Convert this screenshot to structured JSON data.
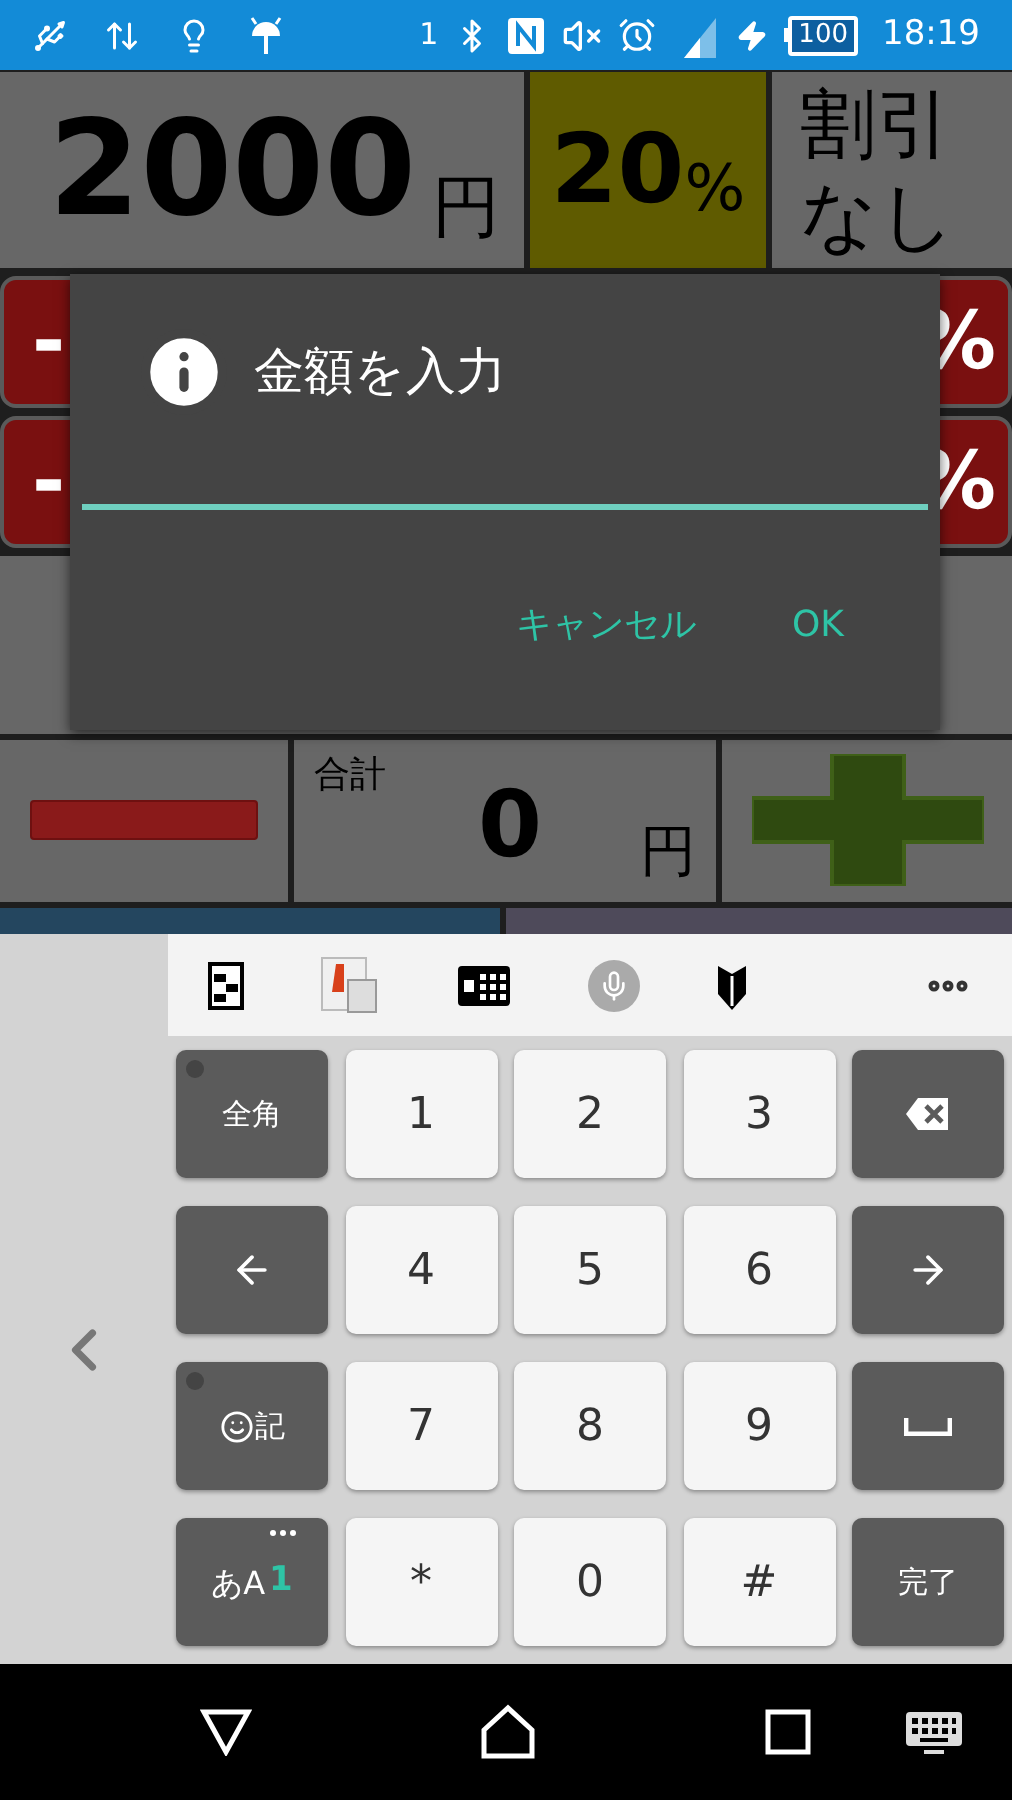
{
  "status_bar": {
    "sim_number": "1",
    "battery": "100",
    "time": "18:19"
  },
  "app": {
    "price": {
      "value": "2000",
      "unit": "円"
    },
    "rate": {
      "value": "20",
      "unit": "%"
    },
    "no_discount_button": "割引なし",
    "discount_buttons_left": [
      "-",
      "-"
    ],
    "discount_buttons_right": [
      "%",
      "%"
    ],
    "total": {
      "label": "合計",
      "value": "0",
      "unit": "円"
    }
  },
  "dialog": {
    "title": "金額を入力",
    "buttons": [
      "キャンセル",
      "OK"
    ]
  },
  "keyboard": {
    "keys": [
      {
        "kind": "function",
        "label": "全角"
      },
      {
        "kind": "digit",
        "label": "1"
      },
      {
        "kind": "digit",
        "label": "2"
      },
      {
        "kind": "digit",
        "label": "3"
      },
      {
        "kind": "backspace"
      },
      {
        "kind": "left"
      },
      {
        "kind": "digit",
        "label": "4"
      },
      {
        "kind": "digit",
        "label": "5"
      },
      {
        "kind": "digit",
        "label": "6"
      },
      {
        "kind": "right"
      },
      {
        "kind": "symbol",
        "label": "記"
      },
      {
        "kind": "digit",
        "label": "7"
      },
      {
        "kind": "digit",
        "label": "8"
      },
      {
        "kind": "digit",
        "label": "9"
      },
      {
        "kind": "space"
      },
      {
        "kind": "mode",
        "label": "あA",
        "accent": "1"
      },
      {
        "kind": "digit",
        "label": "*"
      },
      {
        "kind": "digit",
        "label": "0"
      },
      {
        "kind": "digit",
        "label": "#"
      },
      {
        "kind": "function",
        "label": "完了"
      }
    ]
  }
}
